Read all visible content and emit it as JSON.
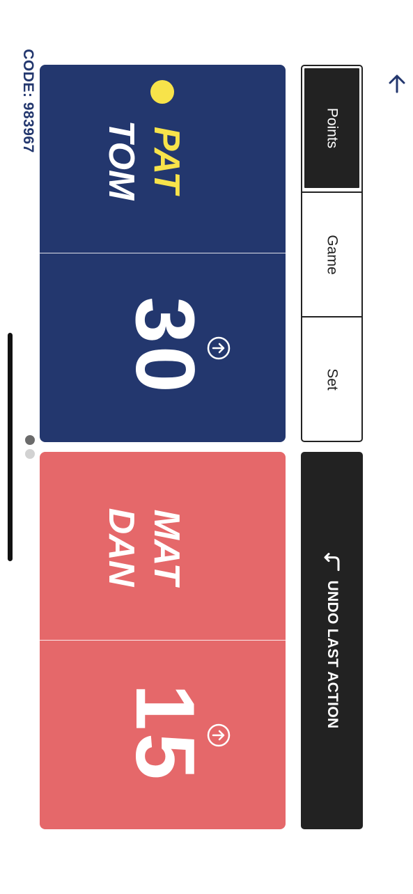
{
  "code_label": "CODE: 983967",
  "tabs": [
    {
      "label": "Points",
      "selected": true
    },
    {
      "label": "Game",
      "selected": false
    },
    {
      "label": "Set",
      "selected": false
    }
  ],
  "undo_label": "UNDO LAST ACTION",
  "team_a": {
    "player_1": "PAT",
    "player_2": "TOM",
    "score": "30",
    "serving": true
  },
  "team_b": {
    "player_1": "MAT",
    "player_2": "DAN",
    "score": "15",
    "serving": false
  },
  "pager": {
    "current": 1,
    "total": 2
  },
  "colors": {
    "team_a_bg": "#23376e",
    "team_b_bg": "#e5686a",
    "serve_highlight": "#f7e34a",
    "dark": "#222222"
  },
  "icons": {
    "back": "arrow-up-icon",
    "undo": "undo-arrow-icon",
    "advance": "circle-arrow-right-icon",
    "serve": "serve-indicator-dot"
  }
}
